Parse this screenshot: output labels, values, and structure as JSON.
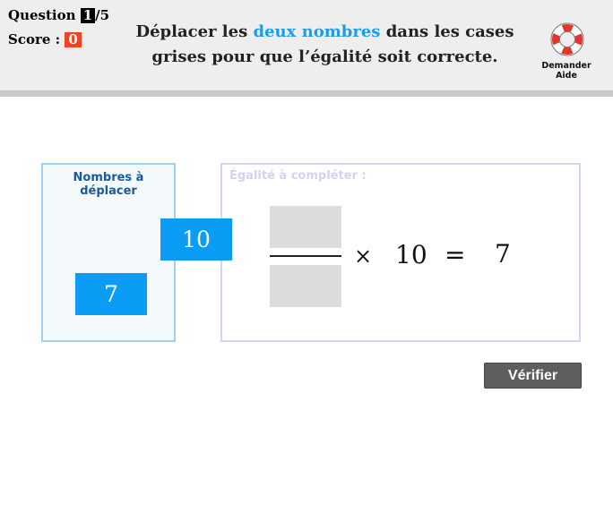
{
  "header": {
    "question_label": "Question",
    "question_current": "1",
    "question_total": "/5",
    "score_label": "Score :",
    "score_value": "0",
    "instruction_before": "Déplacer les ",
    "instruction_highlight": "deux nombres",
    "instruction_after": " dans les cases grises pour que l’égalité soit correcte.",
    "help_label": "Demander Aide",
    "help_icon": "lifebuoy-icon"
  },
  "source_panel": {
    "title": "Nombres à déplacer",
    "tiles": [
      "10",
      "7"
    ]
  },
  "target_panel": {
    "title": "Égalité à compléter :",
    "times_symbol": "×",
    "multiplier": "10",
    "equals_symbol": "=",
    "result": "7"
  },
  "verify_button": "Vérifier",
  "colors": {
    "accent": "#1e9be9",
    "tile": "#0b9cf5",
    "score_badge": "#f04323",
    "button": "#5e5e5e"
  }
}
